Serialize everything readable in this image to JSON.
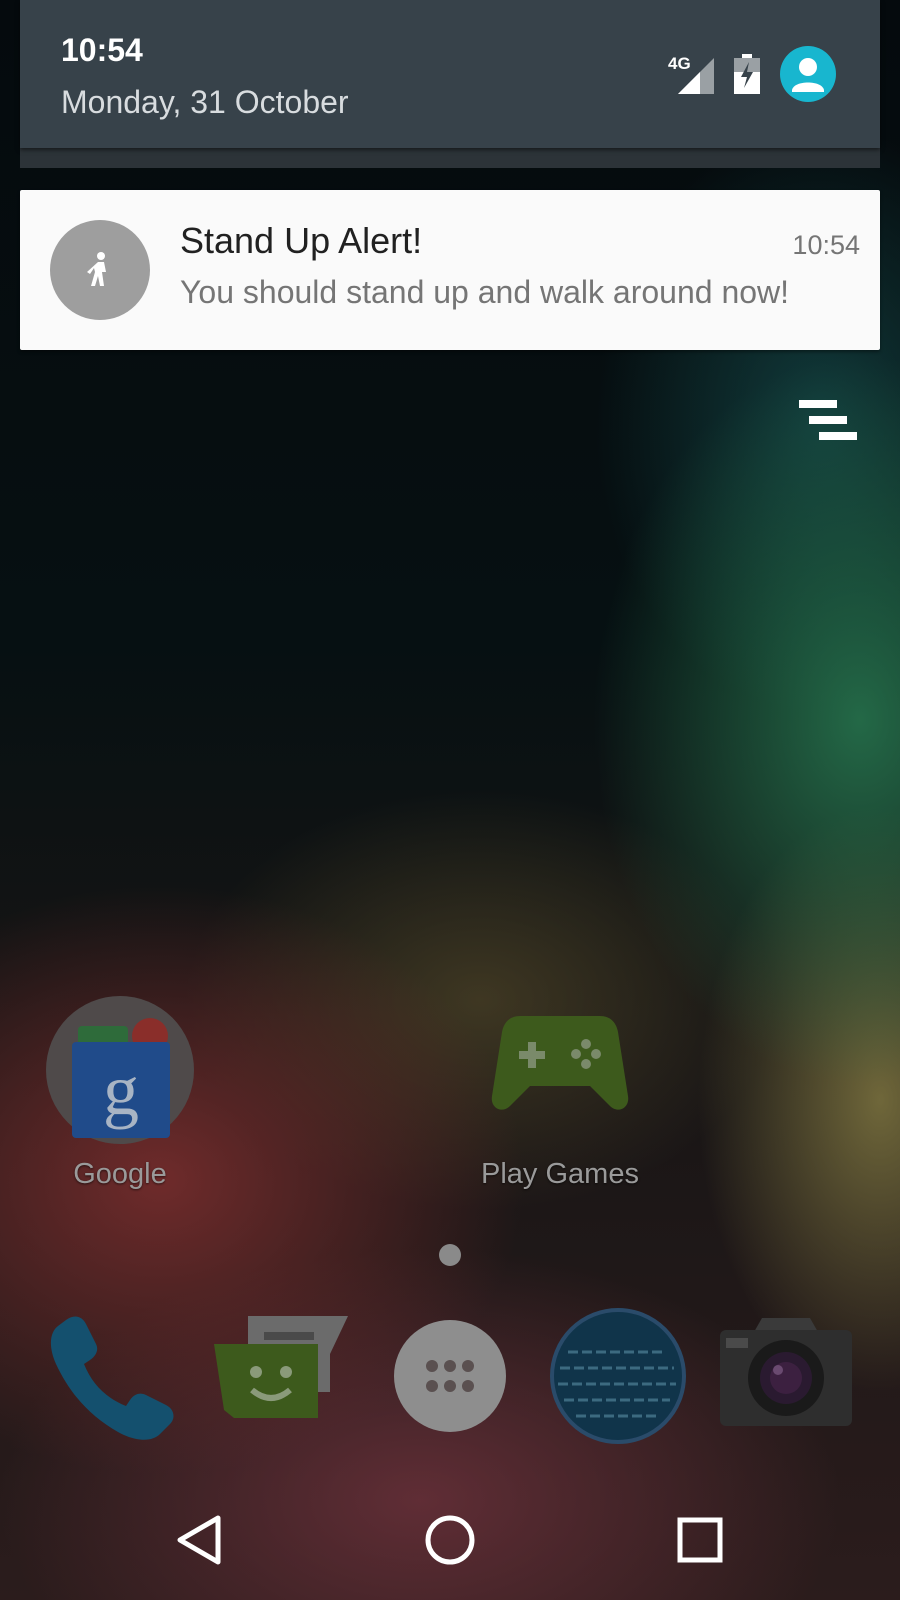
{
  "status": {
    "time": "10:54",
    "date": "Monday, 31 October",
    "network_label": "4G",
    "icons": [
      "signal-4g-icon",
      "battery-charging-icon",
      "user-avatar-icon"
    ]
  },
  "notification": {
    "title": "Stand Up Alert!",
    "time": "10:54",
    "text": "You should stand up and walk around now!",
    "icon": "walking-person-icon"
  },
  "home": {
    "apps": [
      {
        "label": "Google",
        "icon": "google-folder-icon"
      },
      {
        "label": "Play Games",
        "icon": "play-games-icon"
      }
    ],
    "dock": [
      "phone-icon",
      "messenger-icon",
      "app-drawer-icon",
      "browser-globe-icon",
      "camera-icon"
    ]
  },
  "nav": [
    "back-icon",
    "home-icon",
    "recents-icon"
  ],
  "colors": {
    "header_bg": "#37424a",
    "avatar_accent": "#18b6cf",
    "notification_bg": "#fafafa",
    "notification_icon_bg": "#9e9e9e"
  }
}
